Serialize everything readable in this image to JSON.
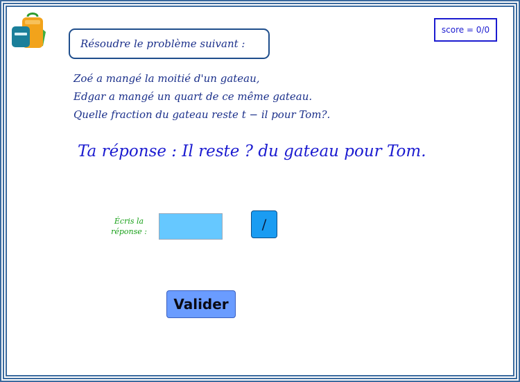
{
  "header": {
    "instruction": "Résoudre le problème suivant :",
    "score": "score = 0/0"
  },
  "problem": {
    "lines": [
      "Zoé a mangé la moitié d'un gateau,",
      "Edgar a mangé un quart de ce même gateau.",
      "Quelle fraction du gateau reste t − il pour Tom?."
    ]
  },
  "answer": {
    "sentence": "Ta réponse : Il reste ? du gateau pour Tom."
  },
  "form": {
    "prompt_line1": "Écris la",
    "prompt_line2": "réponse :",
    "input_value": "",
    "fraction_button": "/",
    "submit_label": "Valider"
  },
  "colors": {
    "frame": "#3a6a9e",
    "text_dark_blue": "#1a2f8a",
    "text_blue": "#1b1bd0",
    "prompt_green": "#18a018",
    "input_bg": "#66c8ff",
    "fraction_button_bg": "#1a9cf2",
    "submit_button_bg": "#6a9cff"
  },
  "icons": {
    "logo": "backpack-icon"
  }
}
